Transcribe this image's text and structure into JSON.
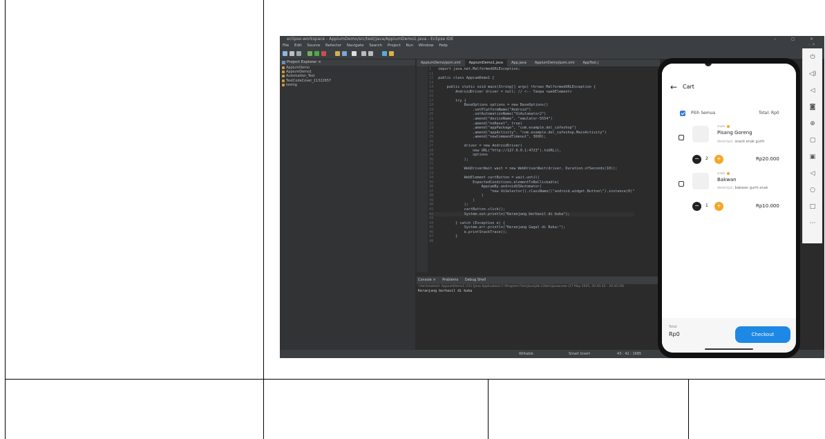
{
  "ide": {
    "title": "eclipse-workspace - AppiumDemo/src/test/java/AppiumDemo1.java - Eclipse IDE",
    "window_controls": "– ◻ ×",
    "menu": [
      "File",
      "Edit",
      "Source",
      "Refactor",
      "Navigate",
      "Search",
      "Project",
      "Run",
      "Window",
      "Help"
    ],
    "explorer": {
      "title": "Project Explorer ×",
      "projects": [
        "AppiumDemo",
        "AppiumDemo1",
        "Automation_Test",
        "TestCodeCover_11322657",
        "testng"
      ]
    },
    "tabs": [
      "AppiumDemo/pom.xml",
      "AppiumDemo1.java",
      "App.java",
      "AppiumDemo/pom.xml",
      "AppTest.j"
    ],
    "code_lines": [
      {
        "n": "1",
        "t": "import java.net.MalformedURLException;"
      },
      {
        "n": "11",
        "t": ""
      },
      {
        "n": "12",
        "t": "public class AppiumDemo1 {"
      },
      {
        "n": "13",
        "t": ""
      },
      {
        "n": "14",
        "t": "    public static void main(String[] args) throws MalformedURLException {"
      },
      {
        "n": "15",
        "t": "        AndroidDriver driver = null; // <-- Tanpa <webElement>"
      },
      {
        "n": "16",
        "t": ""
      },
      {
        "n": "17",
        "t": "        try {"
      },
      {
        "n": "18",
        "t": "            BaseOptions options = new BaseOptions()"
      },
      {
        "n": "19",
        "t": "                .setPlatformName(\"Android\")"
      },
      {
        "n": "20",
        "t": "                .setAutomationName(\"UiAutomator2\")"
      },
      {
        "n": "21",
        "t": "                .amend(\"deviceName\", \"emulator-5554\")"
      },
      {
        "n": "22",
        "t": "                .amend(\"noReset\", true)"
      },
      {
        "n": "23",
        "t": "                .amend(\"appPackage\", \"com.example.del_cafeshop\")"
      },
      {
        "n": "24",
        "t": "                .amend(\"appActivity\", \"com.example.del_cafeshop.MainActivity\")"
      },
      {
        "n": "25",
        "t": "                .amend(\"newCommandTimeout\", 3600);"
      },
      {
        "n": "26",
        "t": ""
      },
      {
        "n": "27",
        "t": "            driver = new AndroidDriver("
      },
      {
        "n": "28",
        "t": "                new URL(\"http://127.0.0.1:4723\").toURL(),"
      },
      {
        "n": "29",
        "t": "                options"
      },
      {
        "n": "30",
        "t": "            );"
      },
      {
        "n": "31",
        "t": ""
      },
      {
        "n": "32",
        "t": "            WebDriverWait wait = new WebDriverWait(driver, Duration.ofSeconds(10));"
      },
      {
        "n": "33",
        "t": ""
      },
      {
        "n": "34",
        "t": "            WebElement cartButton = wait.until("
      },
      {
        "n": "35",
        "t": "                ExpectedConditions.elementToBeClickable("
      },
      {
        "n": "36",
        "t": "                    AppiumBy.androidUIAutomator("
      },
      {
        "n": "37",
        "t": "                        \"new UiSelector().className(\\\"android.widget.Button\\\").instance(0)\""
      },
      {
        "n": "38",
        "t": "                    )"
      },
      {
        "n": "39",
        "t": "                )"
      },
      {
        "n": "40",
        "t": "            );"
      },
      {
        "n": "41",
        "t": "            cartButton.click();"
      },
      {
        "n": "42",
        "t": "            System.out.println(\"Keranjang berhasil di buka\");"
      },
      {
        "n": "43",
        "t": ""
      },
      {
        "n": "44",
        "t": "        } catch (Exception e) {"
      },
      {
        "n": "45",
        "t": "            System.err.println(\"Keranjang Gagal di Buka:\");"
      },
      {
        "n": "46",
        "t": "            e.printStackTrace();"
      },
      {
        "n": "47",
        "t": "        }"
      },
      {
        "n": "48",
        "t": ""
      }
    ],
    "console": {
      "tabs": [
        "Console ×",
        "Problems",
        "Debug Shell"
      ],
      "path": "<terminated> AppiumDemo1 (11) [Java Application] C:\\Program Files\\Java\\jdk-23\\bin\\javaw.exe (27 May 2025, 20:45:33 – 20:45:39)",
      "output": "Keranjang berhasil di buka"
    },
    "status": {
      "mode": "Writable",
      "insert": "Smart Insert",
      "position": "43 : 42 : 1685"
    }
  },
  "app": {
    "header": {
      "title": "Cart",
      "back_icon": "←"
    },
    "select_all": {
      "label": "Pilih Semua",
      "total": "Total: Rp0"
    },
    "items": [
      {
        "category": "snack",
        "name": "Pisang Goreng",
        "desc_label": "deskripsi:",
        "desc": "snack enak gurih",
        "qty": "2",
        "price": "Rp20.000"
      },
      {
        "category": "snack",
        "name": "Bakwan",
        "desc_label": "deskripsi:",
        "desc": "bakwan gurih enak",
        "qty": "1",
        "price": "Rp10.000"
      }
    ],
    "footer": {
      "total_label": "Total",
      "total_value": "Rp0",
      "checkout": "Checkout"
    }
  },
  "colors": {
    "accent": "#1e88e5",
    "plus": "#f5a623",
    "ide_bg": "#2b2b2b"
  }
}
